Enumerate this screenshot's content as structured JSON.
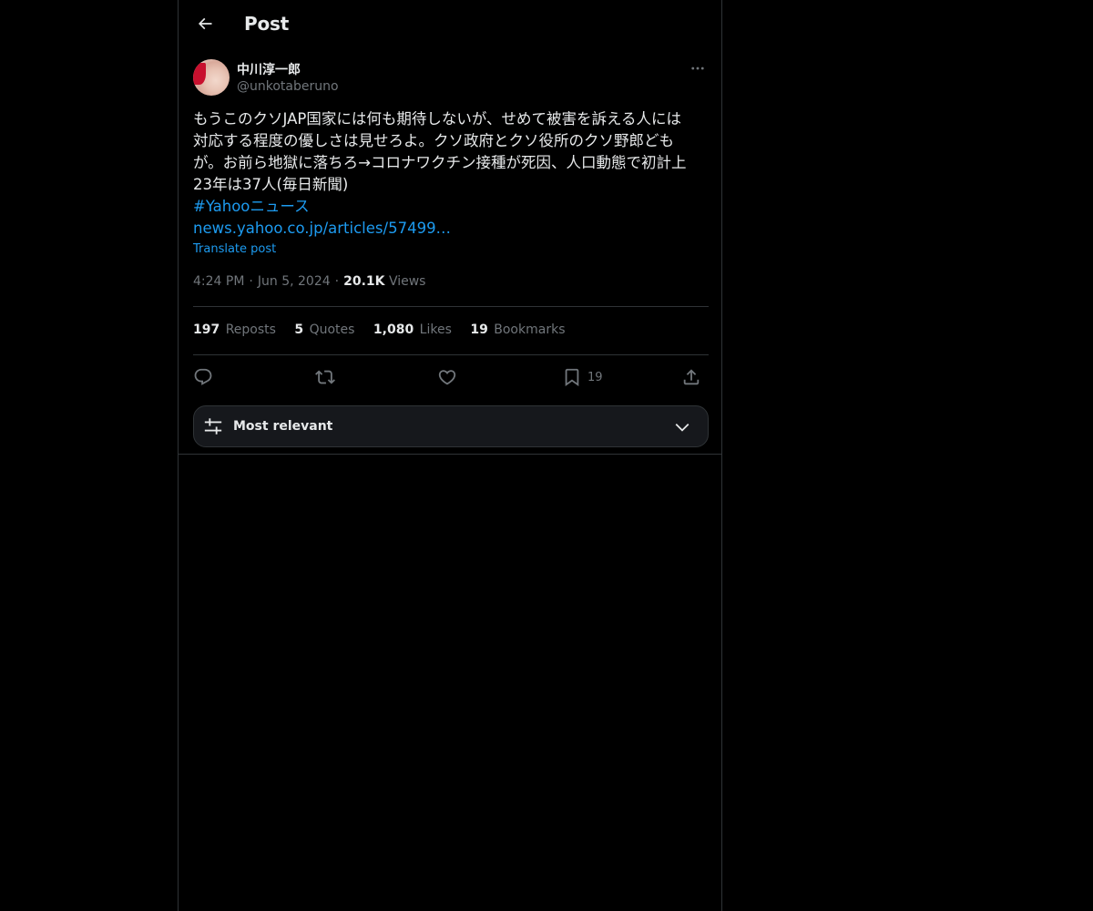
{
  "header": {
    "title": "Post",
    "back_icon": "arrow-left-icon"
  },
  "author": {
    "display_name": "中川淳一郎",
    "handle": "@unkotaberuno"
  },
  "tweet": {
    "lines": [
      "もうこのクソJAP国家には何も期待しないが、せめて被害を訴える人には",
      "対応する程度の優しさは見せろよ。クソ政府とクソ役所のクソ野郎ども",
      "が。お前ら地獄に落ちろ→コロナワクチン接種が死因、人口動態で初計上",
      "23年は37人(毎日新聞)"
    ],
    "hashtag": "#Yahooニュース",
    "link": "news.yahoo.co.jp/articles/57499…",
    "translate_label": "Translate post"
  },
  "meta": {
    "time": "4:24 PM",
    "date": "Jun 5, 2024",
    "views_count": "20.1K",
    "views_label": "Views",
    "separator": "·"
  },
  "stats": [
    {
      "count": "197",
      "label": "Reposts"
    },
    {
      "count": "5",
      "label": "Quotes"
    },
    {
      "count": "1,080",
      "label": "Likes"
    },
    {
      "count": "19",
      "label": "Bookmarks"
    }
  ],
  "actions": {
    "reply_icon": "reply-icon",
    "repost_icon": "repost-icon",
    "like_icon": "heart-icon",
    "bookmark_icon": "bookmark-icon",
    "bookmark_count": "19",
    "share_icon": "share-icon"
  },
  "sort": {
    "label": "Most relevant",
    "icon": "sliders-icon",
    "chevron": "chevron-down-icon"
  },
  "colors": {
    "background": "#000000",
    "text": "#e7e9ea",
    "muted": "#71767b",
    "accent": "#1d9bf0",
    "border": "#2f3336"
  }
}
